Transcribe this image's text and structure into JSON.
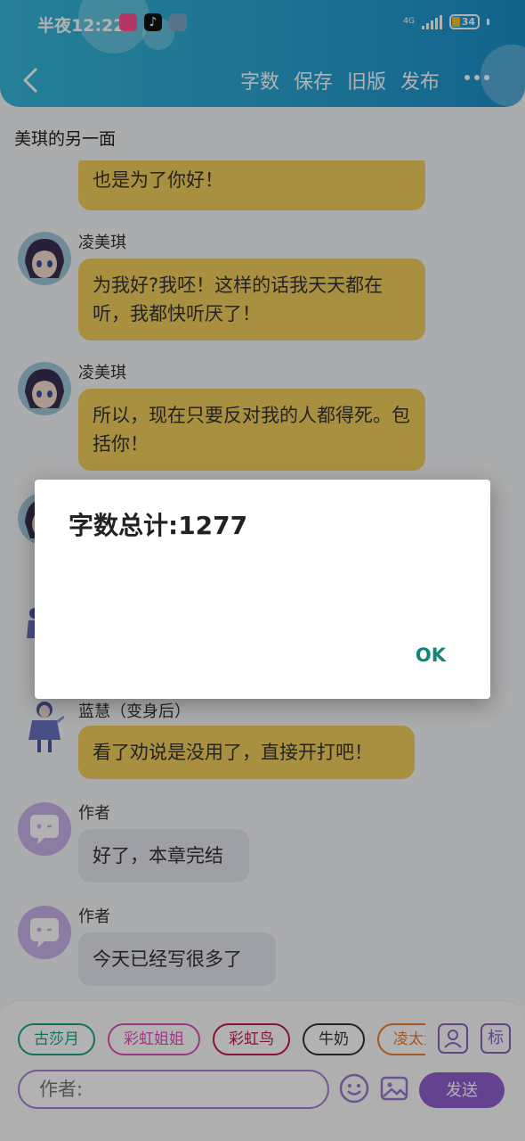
{
  "status_bar": {
    "time": "半夜12:22",
    "network": "4G",
    "battery": "34",
    "colors": {
      "app1": "#ff4f93",
      "app2": "#111111",
      "app3": "#7fa7c4",
      "battery_fill": "#f2c037"
    }
  },
  "header": {
    "back_icon": "chevron-left-icon",
    "actions": [
      "字数",
      "保存",
      "旧版",
      "发布"
    ],
    "more_icon": "more-horizontal-icon",
    "gradient": [
      "#36b7d8",
      "#1b8fca"
    ]
  },
  "chapter_title": "美琪的另一面",
  "messages": [
    {
      "sender": "",
      "text": "也是为了你好！",
      "style": "yellow"
    },
    {
      "sender": "凌美琪",
      "text": "为我好?我呸！这样的话我天天都在听，我都快听厌了！",
      "style": "yellow"
    },
    {
      "sender": "凌美琪",
      "text": "所以，现在只要反对我的人都得死。包括你！",
      "style": "yellow"
    },
    {
      "sender": "蓝慧（变身后）",
      "text": "看了劝说是没用了，直接开打吧！",
      "style": "yellow"
    },
    {
      "sender": "作者",
      "text": "好了，本章完结",
      "style": "gray"
    },
    {
      "sender": "作者",
      "text": "今天已经写很多了",
      "style": "gray"
    }
  ],
  "bubble_colors": {
    "yellow": "#f3cf5c",
    "gray": "#e2e6ec"
  },
  "input_panel": {
    "chips": [
      {
        "label": "古莎月",
        "color": "#17a589"
      },
      {
        "label": "彩虹姐姐",
        "color": "#e14fbf"
      },
      {
        "label": "彩虹鸟",
        "color": "#c2185b"
      },
      {
        "label": "牛奶",
        "color": "#333333"
      },
      {
        "label": "凌太太",
        "color": "#ef7d2f"
      }
    ],
    "character_icon": "person-icon",
    "tag_button": "标",
    "author_placeholder": "作者:",
    "emoji_icon": "smile-icon",
    "image_icon": "image-icon",
    "send_label": "发送",
    "accent": "#8f5fd1"
  },
  "dialog": {
    "title": "字数总计:1277",
    "ok_label": "OK",
    "ok_color": "#12857a"
  }
}
